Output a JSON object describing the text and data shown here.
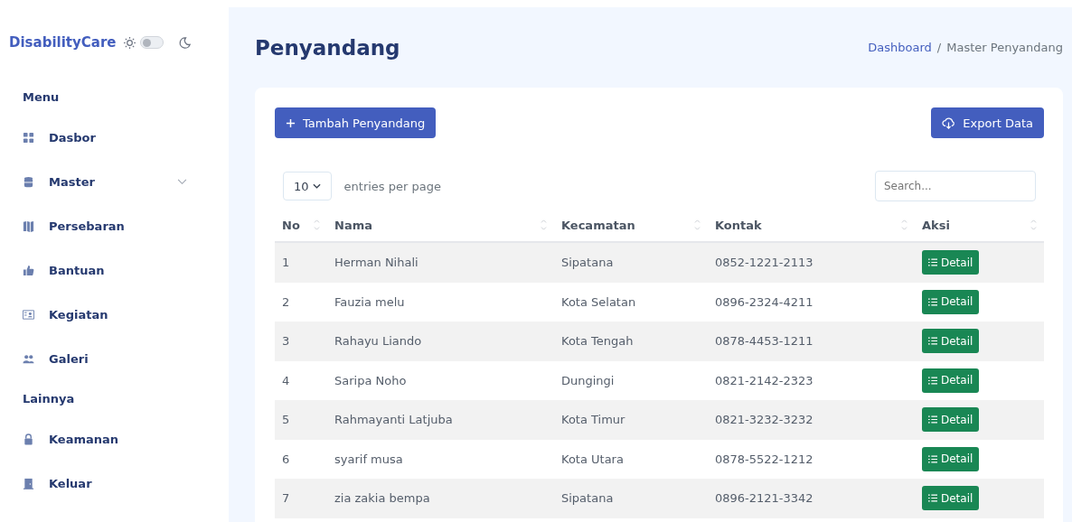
{
  "brand": "DisabilityCare",
  "dark_mode": {
    "on": false
  },
  "sidebar": {
    "sections": [
      {
        "heading": "Menu",
        "items": [
          {
            "label": "Dasbor",
            "kind": "grid"
          },
          {
            "label": "Master",
            "kind": "database",
            "expanded": false
          },
          {
            "label": "Persebaran",
            "kind": "map"
          },
          {
            "label": "Bantuan",
            "kind": "thumb"
          },
          {
            "label": "Kegiatan",
            "kind": "card"
          },
          {
            "label": "Galeri",
            "kind": "people"
          }
        ]
      },
      {
        "heading": "Lainnya",
        "items": [
          {
            "label": "Keamanan",
            "kind": "lock"
          },
          {
            "label": "Keluar",
            "kind": "door"
          }
        ]
      }
    ]
  },
  "page_title": "Penyandang",
  "breadcrumb": [
    "Dashboard",
    "Master Penyandang"
  ],
  "breadcrumb_separator": "/",
  "add_button": "Tambah Penyandang",
  "export_button": "Export Data",
  "page_size": "10",
  "entries_label": "entries per page",
  "search": {
    "placeholder": "Search..."
  },
  "table": {
    "columns": [
      "No",
      "Nama",
      "Kecamatan",
      "Kontak",
      "Aksi"
    ],
    "rows": [
      {
        "no": "1",
        "nama": "Herman Nihali",
        "kecamatan": "Sipatana",
        "kontak": "0852-1221-2113",
        "action": "Detail"
      },
      {
        "no": "2",
        "nama": "Fauzia melu",
        "kecamatan": "Kota Selatan",
        "kontak": "0896-2324-4211",
        "action": "Detail"
      },
      {
        "no": "3",
        "nama": "Rahayu Liando",
        "kecamatan": "Kota Tengah",
        "kontak": "0878-4453-1211",
        "action": "Detail"
      },
      {
        "no": "4",
        "nama": "Saripa Noho",
        "kecamatan": "Dungingi",
        "kontak": "0821-2142-2323",
        "action": "Detail"
      },
      {
        "no": "5",
        "nama": "Rahmayanti Latjuba",
        "kecamatan": "Kota Timur",
        "kontak": "0821-3232-3232",
        "action": "Detail"
      },
      {
        "no": "6",
        "nama": "syarif musa",
        "kecamatan": "Kota Utara",
        "kontak": "0878-5522-1212",
        "action": "Detail"
      },
      {
        "no": "7",
        "nama": "zia zakia bempa",
        "kecamatan": "Sipatana",
        "kontak": "0896-2121-3342",
        "action": "Detail"
      }
    ]
  }
}
